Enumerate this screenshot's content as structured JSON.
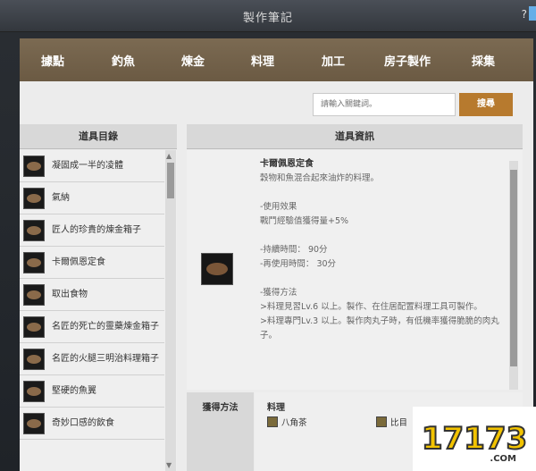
{
  "window": {
    "title": "製作筆記",
    "help": "?"
  },
  "tabs": [
    {
      "label": "據點"
    },
    {
      "label": "釣魚"
    },
    {
      "label": "煉金"
    },
    {
      "label": "料理"
    },
    {
      "label": "加工"
    },
    {
      "label": "房子製作"
    },
    {
      "label": "採集"
    }
  ],
  "search": {
    "placeholder": "請輸入關鍵詞。",
    "button": "搜尋"
  },
  "list": {
    "header": "道具目錄",
    "items": [
      {
        "label": "凝固成一半的凌體"
      },
      {
        "label": "氣納"
      },
      {
        "label": "匠人的珍貴的煉金箱子"
      },
      {
        "label": "卡爾佩恩定食"
      },
      {
        "label": "取出食物"
      },
      {
        "label": "名匠的死亡的靈藥煉金箱子"
      },
      {
        "label": "名匠的火腿三明治料理箱子"
      },
      {
        "label": "堅硬的魚翼"
      },
      {
        "label": "奇妙口感的飲食"
      }
    ]
  },
  "detail": {
    "header": "道具資訊",
    "name": "卡爾佩恩定食",
    "description": "穀物和魚混合起來油炸的料理。",
    "effect_title": "-使用效果",
    "effect": "戰鬥經驗值獲得量+5%",
    "duration": "-持續時間： 90分",
    "cooldown": "-再使用時間： 30分",
    "obtain_title": "-獲得方法",
    "obtain_line1": ">料理見習Lv.6 以上。製作、在住居配置料理工具可製作。",
    "obtain_line2": ">料理專門Lv.3 以上。製作肉丸子時，有低機率獲得脆脆的肉丸子。"
  },
  "obtain": {
    "label": "獲得方法",
    "category": "料理",
    "ingredients": [
      {
        "label": "八角茶"
      },
      {
        "label": "比目"
      }
    ]
  }
}
